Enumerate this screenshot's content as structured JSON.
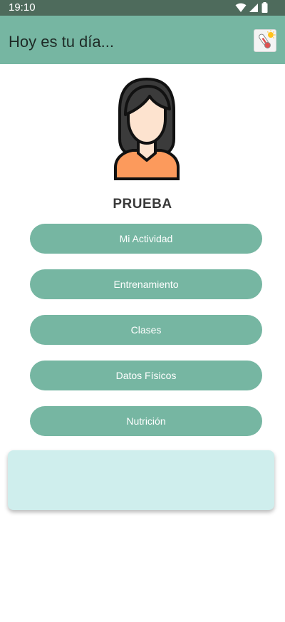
{
  "status_bar": {
    "time": "19:10",
    "icons": [
      "wifi-icon",
      "cellular-icon",
      "battery-icon"
    ]
  },
  "app_bar": {
    "title": "Hoy es tu día...",
    "action_icon": "weather-thermometer-icon"
  },
  "profile": {
    "avatar_icon": "woman-avatar-icon",
    "name": "PRUEBA"
  },
  "menu": [
    {
      "label": "Mi Actividad"
    },
    {
      "label": "Entrenamiento"
    },
    {
      "label": "Clases"
    },
    {
      "label": "Datos Físicos"
    },
    {
      "label": "Nutrición"
    }
  ],
  "colors": {
    "status_bar": "#4e6b5c",
    "primary": "#76b6a2",
    "card": "#cfeeed",
    "avatar_shirt": "#fc9a5c",
    "avatar_skin": "#fde3cf",
    "avatar_hair": "#3b3b3b"
  }
}
